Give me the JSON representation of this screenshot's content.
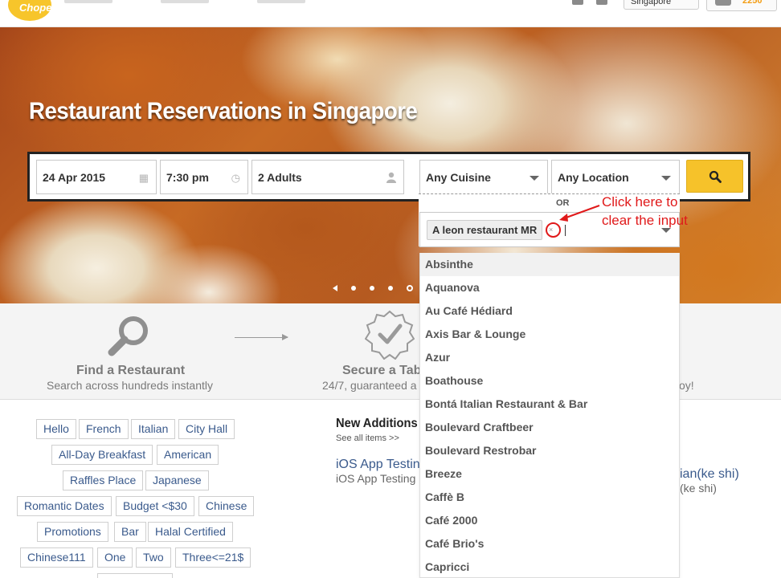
{
  "nav": {
    "logo_text": "Chope",
    "city": "Singapore",
    "points": "2250"
  },
  "hero": {
    "title": "Restaurant Reservations in Singapore"
  },
  "search": {
    "date": "24 Apr 2015",
    "time": "7:30 pm",
    "party": "2 Adults",
    "cuisine": "Any Cuisine",
    "location": "Any Location",
    "or_label": "OR",
    "restaurant_value": "A leon restaurant MR",
    "annotation": "Click here to clear the input"
  },
  "dropdown_options": [
    "Absinthe",
    "Aquanova",
    "Au Café Hédiard",
    "Axis Bar & Lounge",
    "Azur",
    "Boathouse",
    "Bontá Italian Restaurant & Bar",
    "Boulevard Craftbeer",
    "Boulevard Restrobar",
    "Breeze",
    "Caffè B",
    "Café 2000",
    "Café Brio's",
    "Capricci"
  ],
  "steps": {
    "find_title": "Find a Restaurant",
    "find_sub": "Search across hundreds instantly",
    "secure_title": "Secure a Tab",
    "secure_sub": "24/7, guaranteed a",
    "enjoy_sub": "oy!"
  },
  "tags": [
    "Hello",
    "French",
    "Italian",
    "City Hall",
    "All-Day Breakfast",
    "American",
    "Raffles Place",
    "Japanese",
    "Romantic Dates",
    "Budget <$30",
    "Chinese",
    "Promotions",
    "Bar",
    "Halal Certified",
    "Chinese111",
    "One",
    "Two",
    "Three<=21$"
  ],
  "new_additions": {
    "title": "New Additions",
    "see_all": "See all items >>",
    "item1_title": "iOS App Testin",
    "item1_sub": "iOS App Testing",
    "item2_title": "ian(ke shi)",
    "item2_sub": "(ke shi)"
  },
  "colors": {
    "accent_yellow": "#f6c22a",
    "link_blue": "#3a5a8c",
    "annotation_red": "#e0191a"
  }
}
